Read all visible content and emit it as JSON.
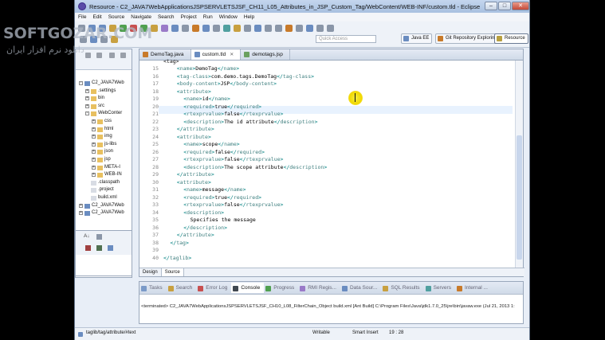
{
  "window": {
    "title": "Resource - C2_JAVA7WebApplicationsJSPSERVLETSJSF_CH11_L05_Attributes_in_JSP_Custom_Tag/WebContent/WEB-INF/custom.tld - Eclipse",
    "controls": [
      "–",
      "□",
      "✕"
    ]
  },
  "menu": [
    "File",
    "Edit",
    "Source",
    "Navigate",
    "Search",
    "Project",
    "Run",
    "Window",
    "Help"
  ],
  "toolbar": {
    "quick_access_placeholder": "Quick Access",
    "perspectives": [
      "Java EE",
      "Git Repository Exploring",
      "Resource"
    ]
  },
  "watermark": {
    "line1": "SOFTGOZAR.COM",
    "line2": "دانلود نرم افزار ایران"
  },
  "explorer": {
    "items": [
      {
        "label": "C2_JAVA7Web",
        "depth": 0,
        "exp": "-",
        "kind": "project"
      },
      {
        "label": ".settings",
        "depth": 1,
        "exp": "+",
        "kind": "folder"
      },
      {
        "label": "bin",
        "depth": 1,
        "exp": "+",
        "kind": "folder"
      },
      {
        "label": "src",
        "depth": 1,
        "exp": "+",
        "kind": "folder"
      },
      {
        "label": "WebConter",
        "depth": 1,
        "exp": "-",
        "kind": "folder"
      },
      {
        "label": "css",
        "depth": 2,
        "exp": "+",
        "kind": "folder"
      },
      {
        "label": "html",
        "depth": 2,
        "exp": "+",
        "kind": "folder"
      },
      {
        "label": "img",
        "depth": 2,
        "exp": "+",
        "kind": "folder"
      },
      {
        "label": "js-libs",
        "depth": 2,
        "exp": "+",
        "kind": "folder"
      },
      {
        "label": "json",
        "depth": 2,
        "exp": "+",
        "kind": "folder"
      },
      {
        "label": "jsp",
        "depth": 2,
        "exp": "+",
        "kind": "folder"
      },
      {
        "label": "META-I",
        "depth": 2,
        "exp": "+",
        "kind": "folder"
      },
      {
        "label": "WEB-IN",
        "depth": 2,
        "exp": "+",
        "kind": "folder"
      },
      {
        "label": ".classpath",
        "depth": 1,
        "exp": "",
        "kind": "file"
      },
      {
        "label": ".project",
        "depth": 1,
        "exp": "",
        "kind": "file"
      },
      {
        "label": "build.xml",
        "depth": 1,
        "exp": "",
        "kind": "file"
      },
      {
        "label": "C2_JAVA7Web",
        "depth": 0,
        "exp": "+",
        "kind": "project"
      },
      {
        "label": "C2_JAVA7Web",
        "depth": 0,
        "exp": "+",
        "kind": "project"
      }
    ]
  },
  "editor": {
    "tabs": [
      {
        "label": "DemoTag.java",
        "color": "#c87a2a",
        "active": false
      },
      {
        "label": "custom.tld",
        "color": "#6a8cc0",
        "active": true
      },
      {
        "label": "demotags.jsp",
        "color": "#6aa060",
        "active": false
      }
    ],
    "top_partial": "<tag>",
    "lines": [
      {
        "n": "15",
        "indent": 4,
        "tag": "name",
        "text": "DemoTag"
      },
      {
        "n": "16",
        "indent": 4,
        "tag": "tag-class",
        "text": "com.demo.tags.DemoTag"
      },
      {
        "n": "17",
        "indent": 4,
        "tag": "body-content",
        "text": "JSP"
      },
      {
        "n": "18",
        "indent": 4,
        "open": "attribute"
      },
      {
        "n": "19",
        "indent": 6,
        "tag": "name",
        "text": "id"
      },
      {
        "n": "20",
        "indent": 6,
        "tag": "required",
        "text": "true"
      },
      {
        "n": "21",
        "indent": 6,
        "tag": "rtexprvalue",
        "text": "false"
      },
      {
        "n": "22",
        "indent": 6,
        "tag": "description",
        "text": "The id attribute"
      },
      {
        "n": "23",
        "indent": 4,
        "close": "attribute"
      },
      {
        "n": "24",
        "indent": 4,
        "open": "attribute"
      },
      {
        "n": "25",
        "indent": 6,
        "tag": "name",
        "text": "scope"
      },
      {
        "n": "26",
        "indent": 6,
        "tag": "required",
        "text": "false"
      },
      {
        "n": "27",
        "indent": 6,
        "tag": "rtexprvalue",
        "text": "false"
      },
      {
        "n": "28",
        "indent": 6,
        "tag": "description",
        "text": "The scope attribute"
      },
      {
        "n": "29",
        "indent": 4,
        "close": "attribute"
      },
      {
        "n": "30",
        "indent": 4,
        "open": "attribute"
      },
      {
        "n": "31",
        "indent": 6,
        "tag": "name",
        "text": "message"
      },
      {
        "n": "32",
        "indent": 6,
        "tag": "required",
        "text": "true"
      },
      {
        "n": "33",
        "indent": 6,
        "tag": "rtexprvalue",
        "text": "false"
      },
      {
        "n": "34",
        "indent": 6,
        "open": "description"
      },
      {
        "n": "35",
        "indent": 8,
        "plain": "Specifies the message"
      },
      {
        "n": "36",
        "indent": 6,
        "close": "description"
      },
      {
        "n": "37",
        "indent": 4,
        "close": "attribute"
      },
      {
        "n": "38",
        "indent": 2,
        "close": "tag"
      },
      {
        "n": "39",
        "indent": 0,
        "plain": ""
      },
      {
        "n": "40",
        "indent": 0,
        "close": "taglib"
      }
    ],
    "design_tabs": [
      "Design",
      "Source"
    ]
  },
  "bottom": {
    "tabs": [
      {
        "label": "Tasks",
        "color": "#7a9ac8",
        "active": false
      },
      {
        "label": "Search",
        "color": "#c8a040",
        "active": false
      },
      {
        "label": "Error Log",
        "color": "#c85050",
        "active": false
      },
      {
        "label": "Console",
        "color": "#404850",
        "active": true
      },
      {
        "label": "Progress",
        "color": "#50a050",
        "active": false
      },
      {
        "label": "RMI Regis...",
        "color": "#9a7ac8",
        "active": false
      },
      {
        "label": "Data Sour...",
        "color": "#6a8cc0",
        "active": false
      },
      {
        "label": "SQL Results",
        "color": "#c8a040",
        "active": false
      },
      {
        "label": "Servers",
        "color": "#50a0a0",
        "active": false
      },
      {
        "label": "Internal ...",
        "color": "#c87a2a",
        "active": false
      }
    ],
    "console_text": "<terminated> C2_JAVA7WebApplicationsJSPSERVLETSJSF_CH10_L08_FilterChain_Object build.xml [Ant Build] C:\\Program Files\\Java\\jdk1.7.0_25\\jre\\bin\\javaw.exe (Jul 21, 2013 1:"
  },
  "status": {
    "path": "taglib/tag/attribute/#text",
    "writable": "Writable",
    "insert_mode": "Smart Insert",
    "position": "19 : 28"
  },
  "colors": {
    "tag": "#3f7f7f",
    "bracket": "#008080",
    "text": "#000000",
    "current_line": "#e8f2fe"
  }
}
